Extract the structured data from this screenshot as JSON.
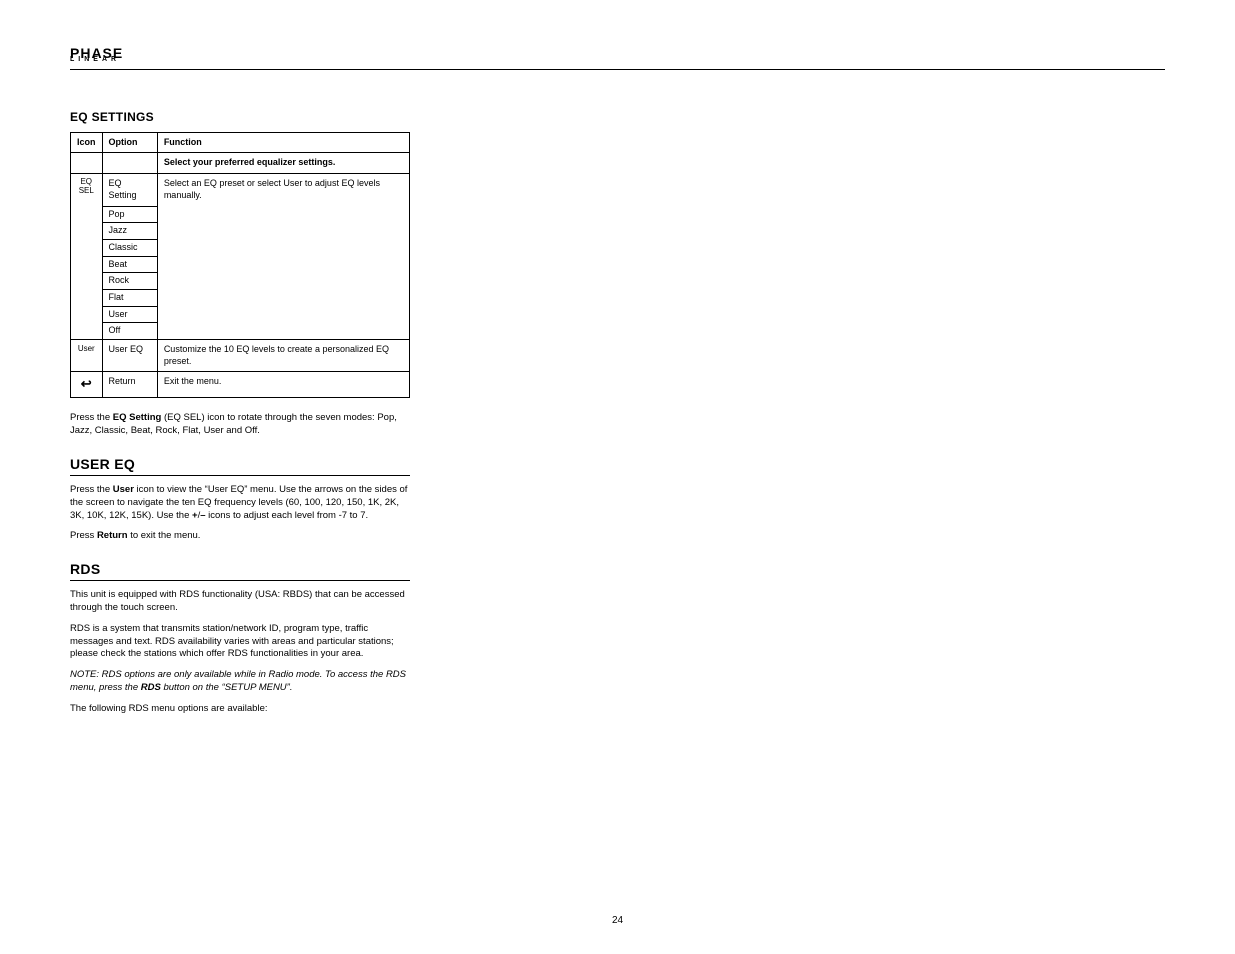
{
  "logo": {
    "line1": "PHASE",
    "line2": "LINEAR"
  },
  "sections": {
    "eq_settings": {
      "title": "EQ SETTINGS",
      "headers": [
        "Icon",
        "Option",
        "Function"
      ],
      "row_blank": {
        "icon": "",
        "option": "",
        "func_l1": "Select your preferred",
        "func_l2": "equalizer settings."
      },
      "row_eq": {
        "icon_l1": "EQ",
        "icon_l2": "SEL",
        "option": "EQ Setting",
        "opts": [
          "Pop",
          "Jazz",
          "Classic",
          "Beat",
          "Rock",
          "Flat",
          "User",
          "Off"
        ],
        "func_l1": "Select an EQ preset",
        "func_l2": "or select User to",
        "func_l3": "adjust EQ levels",
        "func_l4": "manually."
      },
      "row_user": {
        "icon": "User",
        "option": "User EQ",
        "func_l1": "Customize the 10",
        "func_l2": "EQ levels to create",
        "func_l3": "a personalized EQ",
        "func_l4": "preset."
      },
      "row_return": {
        "icon": "↩",
        "option": "Return",
        "func": "Exit the menu."
      }
    },
    "eq_setting_body": {
      "l1a": "Press the ",
      "l1b": "EQ Setting",
      "l1c": " (EQ SEL) icon to rotate through the seven modes: Pop, Jazz, Classic, Beat, Rock, Flat, User and Off."
    },
    "user_eq": {
      "title": "USER EQ",
      "p1a": "Press the ",
      "p1b": "User",
      "p1c": " icon to view the “User EQ” menu. Use the arrows on the sides of the screen to navigate the ten EQ frequency levels (60, 100, 120, 150, 1K, 2K, 3K, 10K, 12K, 15K). Use the ",
      "p1d": "+",
      "p1e": "/",
      "p1f": "–",
      "p1g": " icons to adjust each level from -7 to 7.",
      "p2a": "Press ",
      "p2b": "Return",
      "p2c": " to exit the menu."
    },
    "rds": {
      "title": "RDS",
      "p1": "This unit is equipped with RDS functionality (USA: RBDS) that can be accessed through the touch screen.",
      "p2": "RDS is a system that transmits station/network ID, program type, traffic messages and text. RDS availability varies with areas and particular stations; please check the stations which offer RDS functionalities in your area.",
      "p3a": "NOTE: RDS options are only available while in Radio mode. To access the RDS menu, press the ",
      "p3b": "RDS",
      "p3c": " button on the “SETUP MENU”.",
      "p4": "The following RDS menu options are available:"
    }
  },
  "page_number": "24"
}
